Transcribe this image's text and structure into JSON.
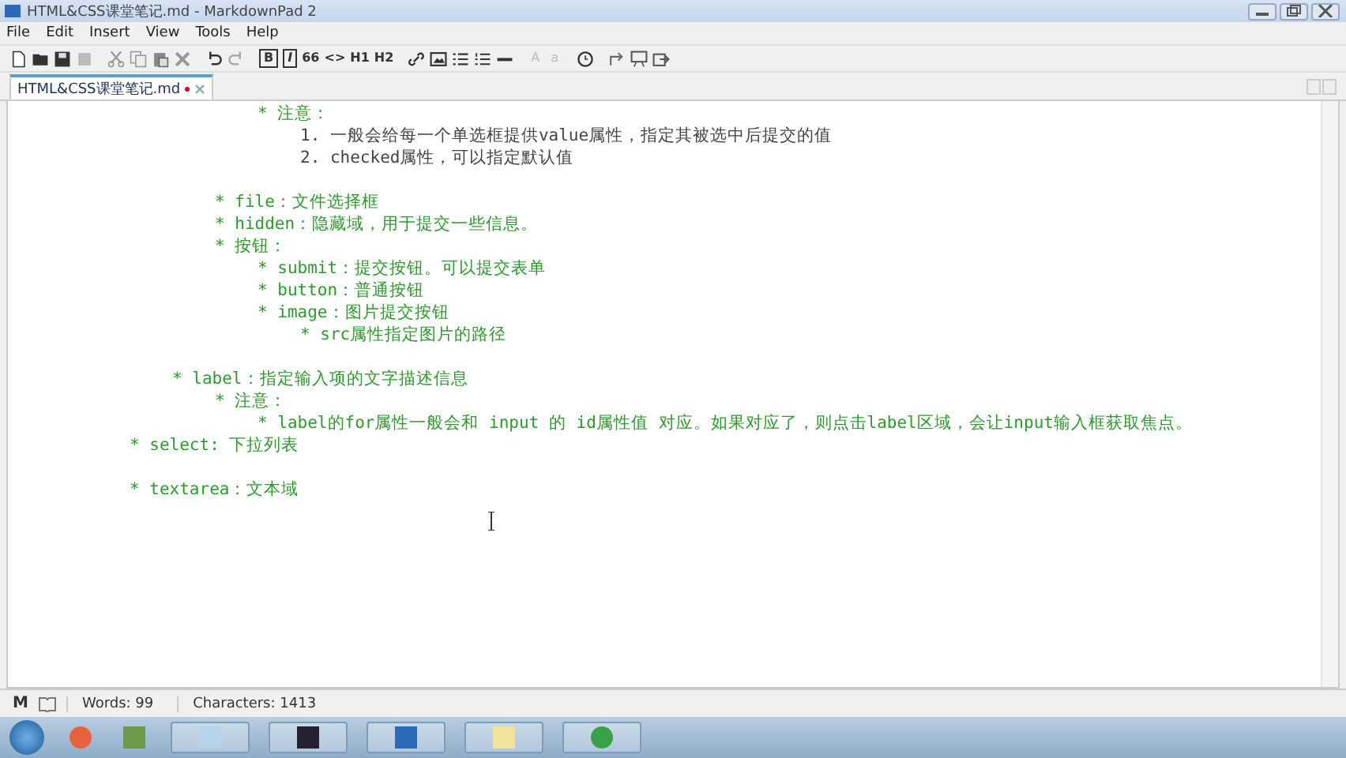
{
  "window": {
    "title": "HTML&CSS课堂笔记.md - MarkdownPad 2"
  },
  "menu": [
    "File",
    "Edit",
    "Insert",
    "View",
    "Tools",
    "Help"
  ],
  "toolbar": [
    {
      "kind": "new"
    },
    {
      "kind": "open"
    },
    {
      "kind": "save"
    },
    {
      "kind": "saveall"
    },
    {
      "kind": "sep"
    },
    {
      "kind": "cut"
    },
    {
      "kind": "copy"
    },
    {
      "kind": "paste"
    },
    {
      "kind": "delete"
    },
    {
      "kind": "sep"
    },
    {
      "kind": "undo"
    },
    {
      "kind": "redo"
    },
    {
      "kind": "sep"
    },
    {
      "kind": "boxed",
      "label": "B"
    },
    {
      "kind": "boxed",
      "label": "I"
    },
    {
      "kind": "text",
      "label": "66"
    },
    {
      "kind": "text",
      "label": "<>"
    },
    {
      "kind": "text",
      "label": "H1"
    },
    {
      "kind": "text",
      "label": "H2"
    },
    {
      "kind": "sep"
    },
    {
      "kind": "link"
    },
    {
      "kind": "image"
    },
    {
      "kind": "ul"
    },
    {
      "kind": "ol"
    },
    {
      "kind": "hr"
    },
    {
      "kind": "sep"
    },
    {
      "kind": "faint",
      "label": "A"
    },
    {
      "kind": "faint",
      "label": "a"
    },
    {
      "kind": "sep"
    },
    {
      "kind": "clock"
    },
    {
      "kind": "sep"
    },
    {
      "kind": "sync"
    },
    {
      "kind": "preview"
    },
    {
      "kind": "export"
    }
  ],
  "tabs": [
    {
      "label": "HTML&CSS课堂笔记.md",
      "selected": true,
      "modified": true
    }
  ],
  "document": [
    [
      {
        "children": [
          {
            "children": [
              {
                "children": [
                  {
                    "kind": "bullet",
                    "text": "* 注意：",
                    "children": [
                      {
                        "kind": "numbered",
                        "text": "1. 一般会给每一个单选框提供value属性，指定其被选中后提交的值"
                      },
                      {
                        "kind": "numbered",
                        "text": "2. checked属性，可以指定默认值"
                      }
                    ]
                  }
                ]
              }
            ]
          }
        ]
      }
    ],
    [
      {
        "children": [
          {
            "children": [
              {
                "kind": "bullet",
                "text": "* file：文件选择框"
              },
              {
                "kind": "bullet",
                "text": "* hidden：隐藏域，用于提交一些信息。"
              },
              {
                "kind": "bullet",
                "text": "* 按钮：",
                "children": [
                  {
                    "kind": "bullet",
                    "text": "* submit：提交按钮。可以提交表单"
                  },
                  {
                    "kind": "bullet",
                    "text": "* button：普通按钮"
                  },
                  {
                    "kind": "bullet",
                    "text": "* image：图片提交按钮",
                    "children": [
                      {
                        "kind": "bullet",
                        "text": "* src属性指定图片的路径"
                      }
                    ]
                  }
                ]
              }
            ]
          }
        ]
      }
    ],
    [
      {
        "children": [
          {
            "kind": "bullet",
            "text": "* label：指定输入项的文字描述信息",
            "children": [
              {
                "kind": "bullet",
                "text": "* 注意：",
                "children": [
                  {
                    "kind": "bullet",
                    "text": "* label的for属性一般会和 input 的 id属性值 对应。如果对应了，则点击label区域，会让input输入框获取焦点。"
                  }
                ]
              }
            ]
          }
        ]
      },
      {
        "kind": "bullet",
        "text": "* select: 下拉列表"
      }
    ],
    [
      {
        "kind": "bullet",
        "text": "* textarea：文本域"
      }
    ]
  ],
  "status_bar": {
    "mode": "M",
    "words": "Words: 99",
    "characters": "Characters: 1413"
  }
}
